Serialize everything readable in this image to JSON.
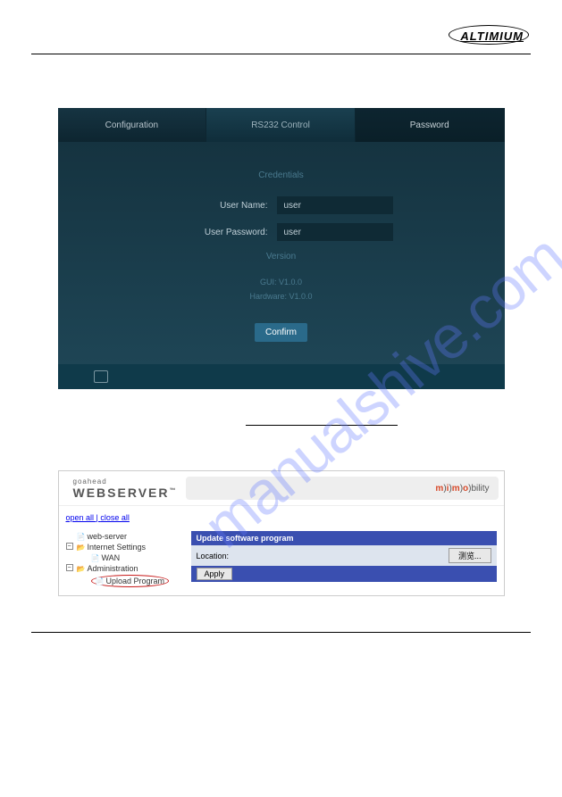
{
  "header": {
    "logo": "ALTIMIUM"
  },
  "watermark": "manualshive.com",
  "panel1": {
    "tabs": {
      "configuration": "Configuration",
      "rs232": "RS232 Control",
      "password": "Password"
    },
    "credentials_title": "Credentials",
    "username_label": "User Name:",
    "username_value": "user",
    "password_label": "User Password:",
    "password_value": "user",
    "version_title": "Version",
    "gui_version": "GUI: V1.0.0",
    "hw_version": "Hardware: V1.0.0",
    "confirm": "Confirm"
  },
  "panel2": {
    "logo_top": "goahead",
    "logo_main": "WEBSERVER",
    "mimo": {
      "m": "m",
      "i": "i",
      "o": "o",
      "bility": "bility"
    },
    "openall": "open all",
    "sep": " | ",
    "closeall": "close all",
    "tree": {
      "webserver": "web-server",
      "internet": "Internet Settings",
      "wan": "WAN",
      "admin": "Administration",
      "upload": "Upload Program"
    },
    "update_title": "Update software program",
    "location_label": "Location:",
    "browse": "测览...",
    "apply": "Apply"
  }
}
